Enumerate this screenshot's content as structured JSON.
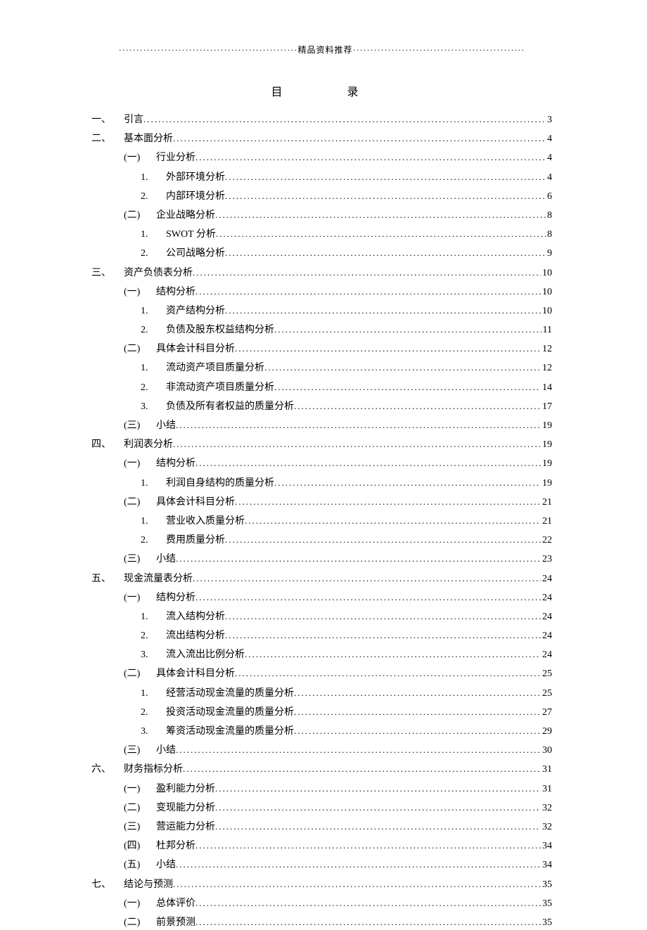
{
  "banner": "···················································精品资料推荐·················································",
  "title": "目　　录",
  "toc": [
    {
      "level": 1,
      "marker": "一、",
      "text": "引言",
      "page": "3"
    },
    {
      "level": 1,
      "marker": "二、",
      "text": "基本面分析",
      "page": "4"
    },
    {
      "level": 2,
      "marker": "(一)",
      "text": "行业分析",
      "page": "4"
    },
    {
      "level": 3,
      "marker": "1.",
      "text": "外部环境分析",
      "page": "4"
    },
    {
      "level": 3,
      "marker": "2.",
      "text": "内部环境分析",
      "page": "6"
    },
    {
      "level": 2,
      "marker": "(二)",
      "text": "企业战略分析",
      "page": "8"
    },
    {
      "level": 3,
      "marker": "1.",
      "text": "SWOT 分析",
      "page": "8"
    },
    {
      "level": 3,
      "marker": "2.",
      "text": "公司战略分析",
      "page": "9"
    },
    {
      "level": 1,
      "marker": "三、",
      "text": "资产负债表分析",
      "page": "10"
    },
    {
      "level": 2,
      "marker": "(一)",
      "text": "结构分析",
      "page": "10"
    },
    {
      "level": 3,
      "marker": "1.",
      "text": "资产结构分析",
      "page": "10"
    },
    {
      "level": 3,
      "marker": "2.",
      "text": "负债及股东权益结构分析",
      "page": "11"
    },
    {
      "level": 2,
      "marker": "(二)",
      "text": "具体会计科目分析",
      "page": "12"
    },
    {
      "level": 3,
      "marker": "1.",
      "text": "流动资产项目质量分析",
      "page": "12"
    },
    {
      "level": 3,
      "marker": "2.",
      "text": "非流动资产项目质量分析",
      "page": "14"
    },
    {
      "level": 3,
      "marker": "3.",
      "text": "负债及所有者权益的质量分析",
      "page": "17"
    },
    {
      "level": 2,
      "marker": "(三)",
      "text": "小结",
      "page": "19"
    },
    {
      "level": 1,
      "marker": "四、",
      "text": "利润表分析",
      "page": "19"
    },
    {
      "level": 2,
      "marker": "(一)",
      "text": "结构分析",
      "page": "19"
    },
    {
      "level": 3,
      "marker": "1.",
      "text": "利润自身结构的质量分析",
      "page": "19"
    },
    {
      "level": 2,
      "marker": "(二)",
      "text": "具体会计科目分析",
      "page": "21"
    },
    {
      "level": 3,
      "marker": "1.",
      "text": "营业收入质量分析",
      "page": "21"
    },
    {
      "level": 3,
      "marker": "2.",
      "text": "费用质量分析",
      "page": "22"
    },
    {
      "level": 2,
      "marker": "(三)",
      "text": "小结",
      "page": "23"
    },
    {
      "level": 1,
      "marker": "五、",
      "text": "现金流量表分析",
      "page": "24"
    },
    {
      "level": 2,
      "marker": "(一)",
      "text": "结构分析",
      "page": "24"
    },
    {
      "level": 3,
      "marker": "1.",
      "text": "流入结构分析",
      "page": "24"
    },
    {
      "level": 3,
      "marker": "2.",
      "text": "流出结构分析",
      "page": "24"
    },
    {
      "level": 3,
      "marker": "3.",
      "text": "流入流出比例分析",
      "page": "24"
    },
    {
      "level": 2,
      "marker": "(二)",
      "text": "具体会计科目分析",
      "page": "25"
    },
    {
      "level": 3,
      "marker": "1.",
      "text": "经营活动现金流量的质量分析",
      "page": "25"
    },
    {
      "level": 3,
      "marker": "2.",
      "text": "投资活动现金流量的质量分析",
      "page": "27"
    },
    {
      "level": 3,
      "marker": "3.",
      "text": "筹资活动现金流量的质量分析",
      "page": "29"
    },
    {
      "level": 2,
      "marker": "(三)",
      "text": "小结",
      "page": "30"
    },
    {
      "level": 1,
      "marker": "六、",
      "text": "财务指标分析",
      "page": "31"
    },
    {
      "level": 2,
      "marker": "(一)",
      "text": "盈利能力分析",
      "page": "31"
    },
    {
      "level": 2,
      "marker": "(二)",
      "text": "变现能力分析",
      "page": "32"
    },
    {
      "level": 2,
      "marker": "(三)",
      "text": "营运能力分析",
      "page": "32"
    },
    {
      "level": 2,
      "marker": "(四)",
      "text": "杜邦分析",
      "page": "34"
    },
    {
      "level": 2,
      "marker": "(五)",
      "text": "小结",
      "page": "34"
    },
    {
      "level": 1,
      "marker": "七、",
      "text": "结论与预测",
      "page": "35"
    },
    {
      "level": 2,
      "marker": "(一)",
      "text": "总体评价",
      "page": "35"
    },
    {
      "level": 2,
      "marker": "(二)",
      "text": "前景预测",
      "page": "35"
    }
  ]
}
